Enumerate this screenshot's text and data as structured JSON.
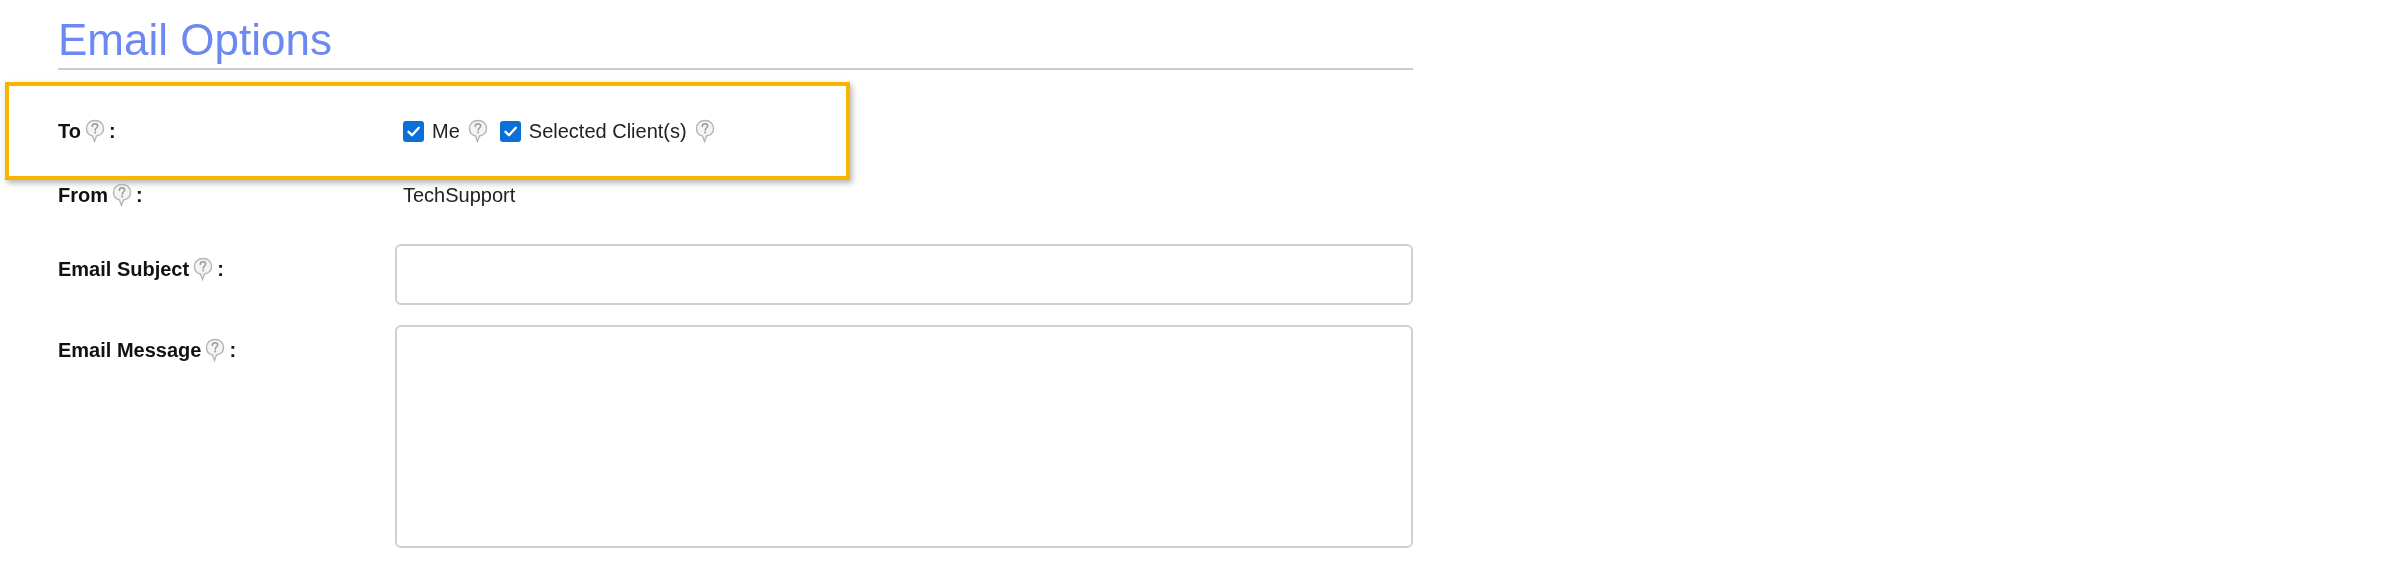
{
  "title": "Email Options",
  "fields": [
    {
      "kind": "checkboxes",
      "label": "To",
      "suffix": ":",
      "highlighted": true,
      "options": [
        {
          "label": "Me",
          "checked": true
        },
        {
          "label": "Selected Client(s)",
          "checked": true
        }
      ]
    },
    {
      "kind": "text",
      "label": "From",
      "suffix": ":",
      "value": "TechSupport"
    },
    {
      "kind": "input",
      "label": "Email Subject",
      "suffix": ":"
    },
    {
      "kind": "textarea",
      "label": "Email Message",
      "suffix": ":"
    }
  ]
}
